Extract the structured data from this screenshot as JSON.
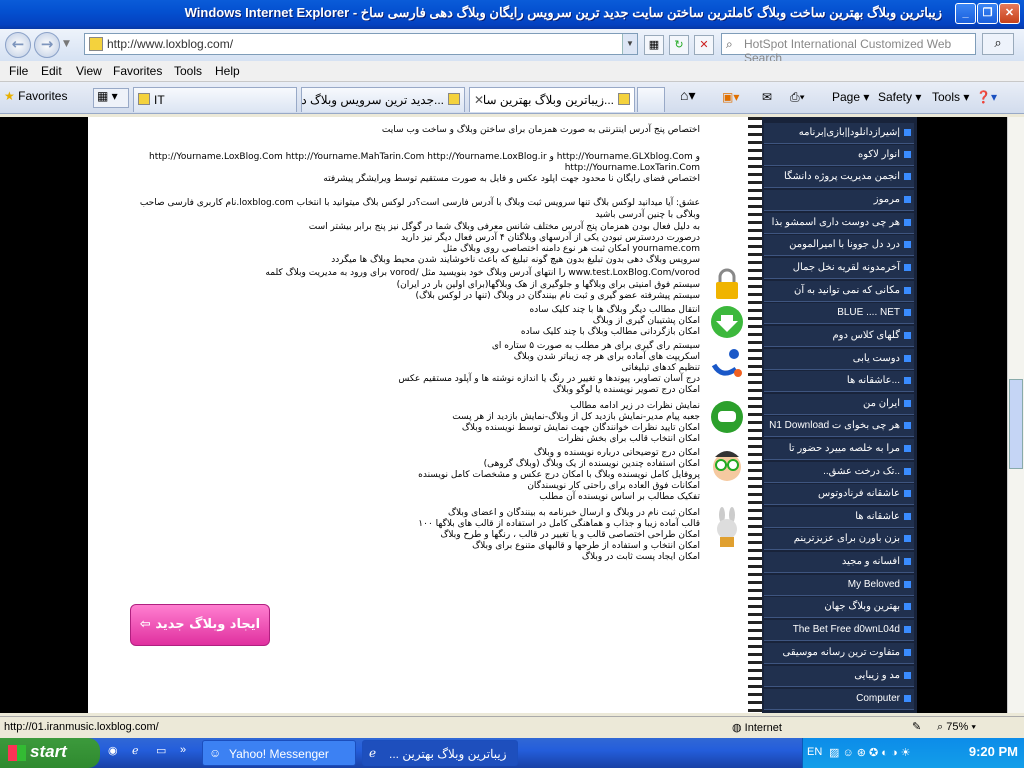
{
  "window": {
    "title": "زیباترین وبلاگ بهترین ساخت وبلاگ کاملترین ساختن سایت جدید ترین سرویس رایگان وبلاگ دهی فارسی ساخ - Windows Internet Explorer"
  },
  "addressbar": {
    "url": "http://www.loxblog.com/",
    "search_placeholder": "HotSpot International Customized Web Search"
  },
  "menu": [
    "File",
    "Edit",
    "View",
    "Favorites",
    "Tools",
    "Help"
  ],
  "tabbar": {
    "favorites": "Favorites",
    "tabs": [
      "IT",
      "...جدید ترین سرویس وبلاگ ده",
      "...زیباترین وبلاگ بهترین سا"
    ],
    "commands": [
      "Page ▾",
      "Safety ▾",
      "Tools ▾"
    ]
  },
  "page": {
    "lines": [
      "اختصاص پنج آدرس اینترنتی به صورت همزمان برای ساختن وبلاگ و ساخت وب سایت",
      "http://Yourname.LoxBlog.Com  http://Yourname.MahTarin.Com  http://Yourname.LoxBlog.ir و http://Yourname.GLXblog.Com و",
      "http://Yourname.LoxTarin.Com",
      "اختصاص فضای رایگان نا محدود جهت اپلود عکس و فایل به صورت مستقیم توسط ویرایشگر پیشرفته",
      "نام کاربری فارسی صاحب.loxblog.com عشق: آیا میدانید لوکس بلاگ تنها سرویس ثبت وبلاگ با آدرس فارسی است؟در لوکس بلاگ میتوانید با انتخاب",
      "وبلاگی با چنین آدرسی باشید",
      "به دلیل فعال بودن همزمان پنج آدرس مختلف شانس معرفی وبلاگ شما در گوگل نیز پنج برابر بیشتر است",
      "درصورت دردسترس نبودن یکی از آدرسهای وبلاگتان ۴ آدرس فعال دیگر نیز دارید",
      "امکان ثبت هر نوع دامنه اختصاصی روی وبلاگ مثل yourname.com",
      "سرویس وبلاگ دهی بدون تبلیغ بدون هیچ گونه تبلیغ که باعث ناخوشایند شدن محیط وبلاگ ها میگردد",
      "برای ورود به مدیریت وبلاگ کلمه vorod/ را انتهای آدرس وبلاگ خود بنویسید مثل www.test.LoxBlog.Com/vorod",
      "سیستم فوق امنیتی برای وبلاگها و جلوگیری از هک وبلاگها(برای اولین بار در ایران)",
      "سیستم پیشرفته عضو گیری و ثبت نام بینندگان در وبلاگ (تنها در لوکس بلاگ)",
      "انتقال مطالب دیگر وبلاگ ها با چند کلیک ساده",
      "امکان پشتیبان گیری از وبلاگ",
      "امکان بازگردانی مطالب وبلاگ با چند کلیک ساده",
      "سیستم رای گیری برای هر مطلب به صورت ۵ ستاره ای",
      "اسکریپت های آماده برای هر چه زیباتر شدن وبلاگ",
      "تنظیم کدهای تبلیغاتی",
      "درج آسان تصاویر، پیوندها و تغییر در رنگ یا اندازه نوشته ها و آپلود مستقیم عکس",
      "امکان درج تصویر نویسنده یا لوگو وبلاگ",
      "نمایش نظرات در زیر ادامه مطالب",
      "جعبه پیام مدیر-نمایش بازدید کل از وبلاگ-نمایش بازدید از هر پست",
      "امکان تایید نظرات خوانندگان جهت نمایش توسط نویسنده وبلاگ",
      "امکان انتخاب قالب برای بخش نظرات",
      "امکان درج توضیحاتی درباره نویسنده و وبلاگ",
      "امکان استفاده چندین نویسنده از یک وبلاگ (وبلاگ گروهی)",
      "پروفایل کامل نویسنده وبلاگ با امکان درج عکس و مشخصات کامل نویسنده",
      "امکانات فوق العاده برای راحتی کار نویسندگان",
      "تفکیک مطالب بر اساس نویسنده آن مطلب",
      "امکان ثبت نام در وبلاگ و ارسال خبرنامه به بینندگان و اعضای وبلاگ",
      "۱۰۰ قالب آماده زیبا و جذاب و هماهنگی کامل در استفاده از قالب های بلاگها",
      "امکان طراحی اختصاصی قالب و یا تغییر در قالب ، رنگها و طرح وبلاگ",
      "امکان انتخاب و استفاده از طرحها و قالبهای متنوع برای وبلاگ",
      "امکان ایجاد پست ثابت در وبلاگ"
    ],
    "create_button": "ایجاد وبلاگ جدید"
  },
  "sidebar": [
    "شیرازدانلود||بازی|برنامه|",
    "انوار لاکوه",
    "انجمن مدیریت پروژه دانشگا",
    "مرموز",
    "هر چی دوست داری اسمشو بذا",
    "درد دل جوونا با امیرالمومن",
    "آخرمدونه لقریه نخل جمال",
    "مکانی که نمی توانید به آن",
    "BLUE .... NET",
    "گلهای کلاس دوم",
    "دوست یابی",
    "عاشقانه ها...",
    "ایران من",
    "N1 Download هر چی بخوای ت",
    "مرا به خلصه مییرد حضور تا",
    "..تک درخت عشق..",
    "عاشقانه فرنادوتوس",
    "عاشقانه ها",
    "بزن باورن برای عزیزترینم",
    "افسانه و مجید",
    "My Beloved",
    "بهترین وبلاگ جهان",
    "The Bet Free d0wnL04d",
    "متفاوت ترین رسانه موسیقی",
    "مد و زیبایی",
    "Computer"
  ],
  "status": {
    "url": "http://01.iranmusic.loxblog.com/",
    "zone": "Internet",
    "zoom": "75%"
  },
  "taskbar": {
    "start": "start",
    "tasks": [
      "Yahoo! Messenger",
      "... زیباترین وبلاگ بهترین"
    ],
    "lang": "EN",
    "time": "9:20 PM"
  }
}
